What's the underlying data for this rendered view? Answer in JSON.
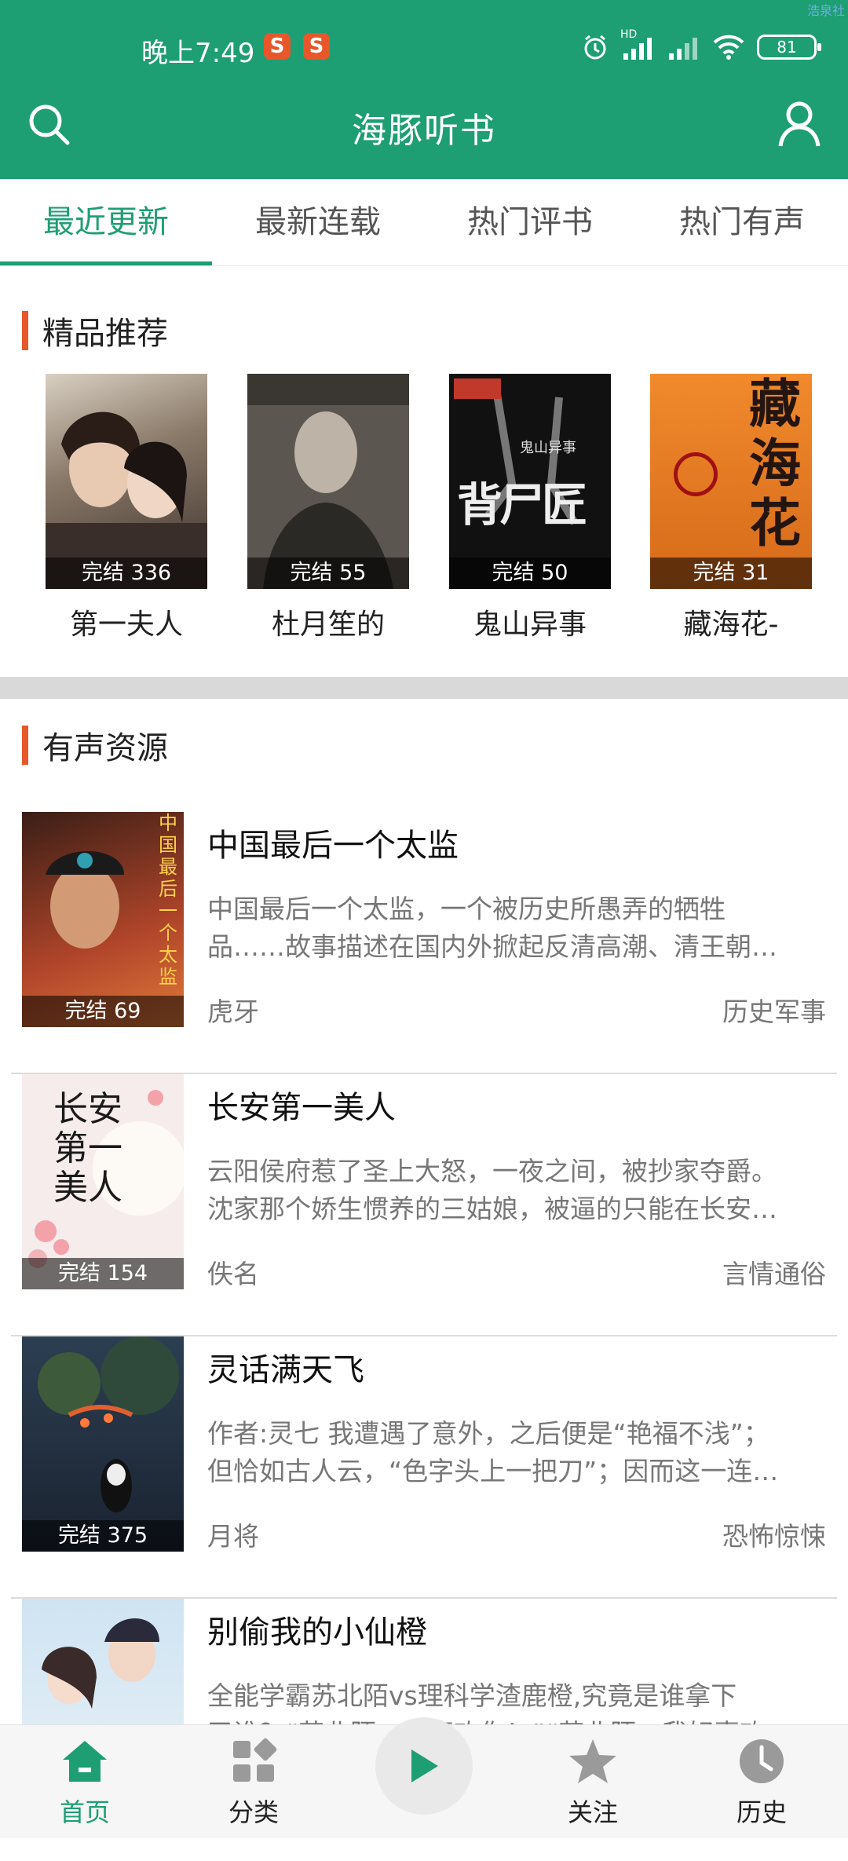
{
  "status_bar": {
    "time": "晚上7:49",
    "notif_badges": [
      "S",
      "S"
    ],
    "network_label": "HD",
    "battery": "81",
    "corner_text": "浩泉社"
  },
  "header": {
    "title": "海豚听书"
  },
  "tabs": [
    {
      "label": "最近更新",
      "active": true
    },
    {
      "label": "最新连载",
      "active": false
    },
    {
      "label": "热门评书",
      "active": false
    },
    {
      "label": "热门有声",
      "active": false
    }
  ],
  "featured": {
    "title": "精品推荐",
    "items": [
      {
        "title": "第一夫人",
        "badge": "完结 336"
      },
      {
        "title": "杜月笙的",
        "badge": "完结 55"
      },
      {
        "title": "鬼山异事",
        "badge": "完结 50",
        "cover_text": "背尸匠",
        "cover_sub": "鬼山异事"
      },
      {
        "title": "藏海花-",
        "badge": "完结 31",
        "cover_text": "藏海花"
      }
    ]
  },
  "audio": {
    "title": "有声资源",
    "items": [
      {
        "title": "中国最后一个太监",
        "desc_line1": "中国最后一个太监，一个被历史所愚弄的牺牲",
        "desc_line2": "品……故事描述在国内外掀起反清高潮、清王朝…",
        "author": "虎牙",
        "category": "历史军事",
        "badge": "完结 69",
        "cover_text": "中国最后一个太监"
      },
      {
        "title": "长安第一美人",
        "desc_line1": "云阳侯府惹了圣上大怒，一夜之间，被抄家夺爵。",
        "desc_line2": "沈家那个娇生惯养的三姑娘，被逼的只能在长安…",
        "author": "佚名",
        "category": "言情通俗",
        "badge": "完结 154",
        "cover_text": "长安第一美人"
      },
      {
        "title": "灵话满天飞",
        "desc_line1": "作者:灵七 我遭遇了意外，之后便是“艳福不浅”；",
        "desc_line2": "但恰如古人云，“色字头上一把刀”；因而这一连…",
        "author": "月将",
        "category": "恐怖惊悚",
        "badge": "完结 375"
      },
      {
        "title": "别偷我的小仙橙",
        "desc_line1": "全能学霸苏北陌vs理科学渣鹿橙,究竟是谁拿下",
        "desc_line2": "了谁？“苏北陌，我喜欢你！”“苏北陌，我好喜欢",
        "author": "",
        "category": "",
        "badge": ""
      }
    ]
  },
  "bottom_nav": [
    {
      "label": "首页",
      "icon": "home-icon",
      "active": true
    },
    {
      "label": "分类",
      "icon": "category-icon",
      "active": false
    },
    {
      "label": "",
      "icon": "play-icon",
      "active": false
    },
    {
      "label": "关注",
      "icon": "star-icon",
      "active": false
    },
    {
      "label": "历史",
      "icon": "clock-icon",
      "active": false
    }
  ],
  "colors": {
    "primary": "#1e9e73",
    "accent": "#e8572a",
    "divider": "#d9d9d9"
  }
}
